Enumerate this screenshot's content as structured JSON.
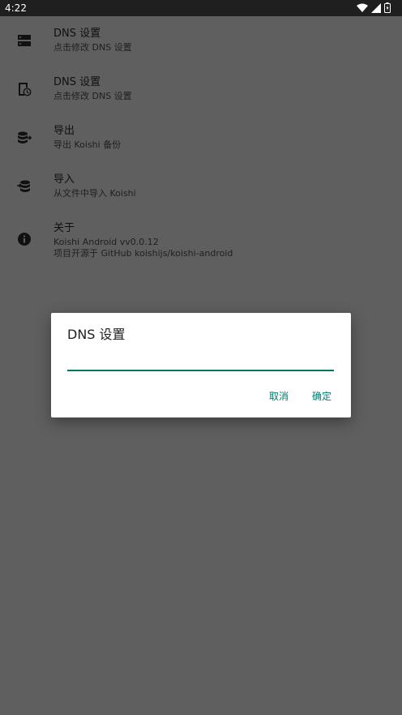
{
  "status_bar": {
    "time": "4:22",
    "icons": [
      "wifi-icon",
      "signal-icon",
      "battery-icon"
    ]
  },
  "settings": [
    {
      "icon": "server-icon",
      "title": "DNS 设置",
      "subtitle": "点击修改 DNS 设置"
    },
    {
      "icon": "dns-clock-icon",
      "title": "DNS 设置",
      "subtitle": "点击修改 DNS 设置"
    },
    {
      "icon": "database-export-icon",
      "title": "导出",
      "subtitle": "导出 Koishi 备份"
    },
    {
      "icon": "database-import-icon",
      "title": "导入",
      "subtitle": "从文件中导入 Koishi"
    },
    {
      "icon": "info-icon",
      "title": "关于",
      "subtitle": "Koishi Android vv0.0.12",
      "subtitle2": "项目开源于 GitHub koishijs/koishi-android"
    }
  ],
  "dialog": {
    "title": "DNS 设置",
    "input_value": "",
    "cancel_label": "取消",
    "ok_label": "确定"
  },
  "colors": {
    "accent": "#00796b",
    "status_bar": "#1f1f1f",
    "scrim_background": "#5f5f5f"
  }
}
